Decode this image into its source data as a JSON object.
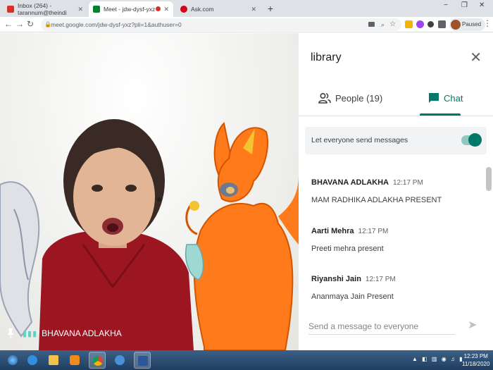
{
  "browser": {
    "tabs": [
      {
        "title": "Inbox (264) - tarannum@theindi",
        "favicon_color": "#d93025"
      },
      {
        "title": "Meet - jdw-dysf-yxz",
        "favicon_color": "#00832d",
        "active": true,
        "recording": true
      },
      {
        "title": "Ask.com",
        "favicon_color": "#d6001c"
      }
    ],
    "new_tab": "+",
    "window_controls": [
      "−",
      "❐",
      "✕"
    ],
    "url": "meet.google.com/jdw-dysf-yxz?pli=1&authuser=0",
    "profile_status": "Paused"
  },
  "meeting": {
    "active_speaker": "BHAVANA ADLAKHA"
  },
  "panel": {
    "title": "library",
    "people_tab": "People (19)",
    "chat_tab": "Chat",
    "toggle_label": "Let everyone send messages",
    "toggle_on": true,
    "messages": [
      {
        "sender": "BHAVANA ADLAKHA",
        "time": "12:17 PM",
        "text": "MAM RADHIKA ADLAKHA PRESENT"
      },
      {
        "sender": "Aarti Mehra",
        "time": "12:17 PM",
        "text": "Preeti mehra present"
      },
      {
        "sender": "Riyanshi Jain",
        "time": "12:17 PM",
        "text": "Ananmaya Jain Present"
      }
    ],
    "compose_placeholder": "Send a message to everyone"
  },
  "taskbar": {
    "time": "12:23 PM",
    "date": "11/18/2020"
  },
  "colors": {
    "accent": "#00796b",
    "taskbar": "#2b4c72"
  }
}
